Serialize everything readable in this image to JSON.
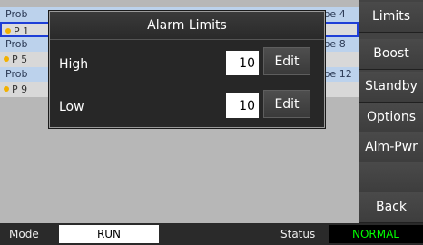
{
  "table": {
    "groups": [
      {
        "header": [
          "Prob",
          "Probe 4"
        ],
        "item": "P 1"
      },
      {
        "header": [
          "Prob",
          "Probe 8"
        ],
        "item": "P 5"
      },
      {
        "header": [
          "Prob",
          "Probe 12"
        ],
        "item": "P 9"
      }
    ]
  },
  "sidebar": {
    "items": [
      "Limits",
      "Boost",
      "Standby",
      "Options",
      "Alm-Pwr",
      "",
      "Back"
    ]
  },
  "dialog": {
    "title": "Alarm Limits",
    "high": {
      "label": "High",
      "value": "10",
      "button": "Edit"
    },
    "low": {
      "label": "Low",
      "value": "10",
      "button": "Edit"
    }
  },
  "status_bar": {
    "mode_label": "Mode",
    "mode_value": "RUN",
    "status_label": "Status",
    "status_value": "NORMAL",
    "status_color": "#00ff00"
  }
}
